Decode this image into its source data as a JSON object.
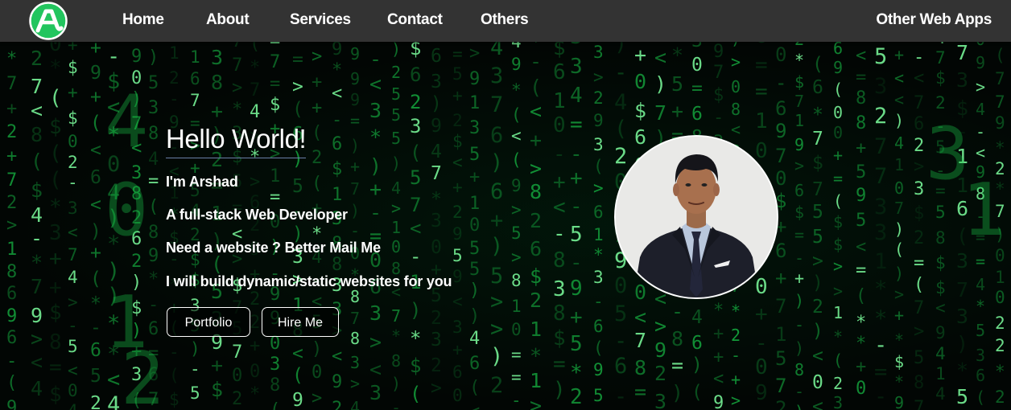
{
  "navbar": {
    "logo_icon": "letter-a-logo",
    "links": [
      "Home",
      "About",
      "Services",
      "Contact",
      "Others"
    ],
    "right_link": "Other Web Apps"
  },
  "hero": {
    "title": "Hello World!",
    "lines": [
      "I'm Arshad",
      "A full-stack Web Developer",
      "Need a website ? Better Mail Me",
      "I will build dynamic/static websites for you"
    ],
    "buttons": {
      "portfolio": "Portfolio",
      "hire": "Hire Me"
    }
  },
  "colors": {
    "navbar": "#333333",
    "accent_green": "#22c55e",
    "matrix_green": "#19c94a",
    "text": "#ffffff"
  },
  "background": {
    "style": "matrix-digital-rain"
  },
  "avatar": {
    "icon": "profile-photo"
  }
}
